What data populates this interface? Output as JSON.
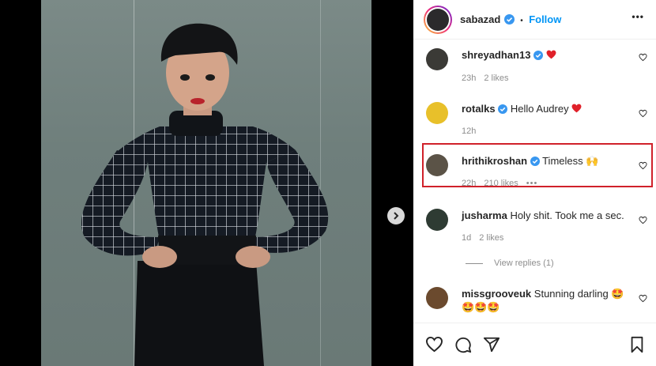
{
  "header": {
    "username": "sabazad",
    "dot": "•",
    "follow_label": "Follow",
    "more_label": "•••"
  },
  "comments": [
    {
      "username": "shreyadhan13",
      "text": "",
      "emoji": "heart-red",
      "time": "23h",
      "likes": "2 likes",
      "avatar_color": "#3b3a36"
    },
    {
      "username": "rotalks",
      "text": "Hello Audrey",
      "emoji": "heart-red",
      "time": "12h",
      "likes": "",
      "avatar_color": "#e8c02a"
    },
    {
      "username": "hrithikroshan",
      "text": "Timeless",
      "emoji": "🙌",
      "time": "22h",
      "likes": "210 likes",
      "more": "•••",
      "avatar_color": "#5b5347"
    },
    {
      "username": "jusharma",
      "text": "Holy shit. Took me a sec.",
      "emoji": "",
      "time": "1d",
      "likes": "2 likes",
      "avatar_color": "#2e3b33"
    },
    {
      "username": "missgrooveuk",
      "text": "Stunning darling 🤩",
      "line2": "🤩🤩🤩",
      "avatar_color": "#6b4a2e"
    }
  ],
  "view_replies": "View replies (1)",
  "colors": {
    "accent": "#0095f6",
    "highlight": "#d0212a",
    "heart": "#ed4956"
  },
  "icons": [
    "like-icon",
    "comment-icon",
    "share-icon",
    "save-icon",
    "verified-badge-icon",
    "next-arrow-icon"
  ]
}
